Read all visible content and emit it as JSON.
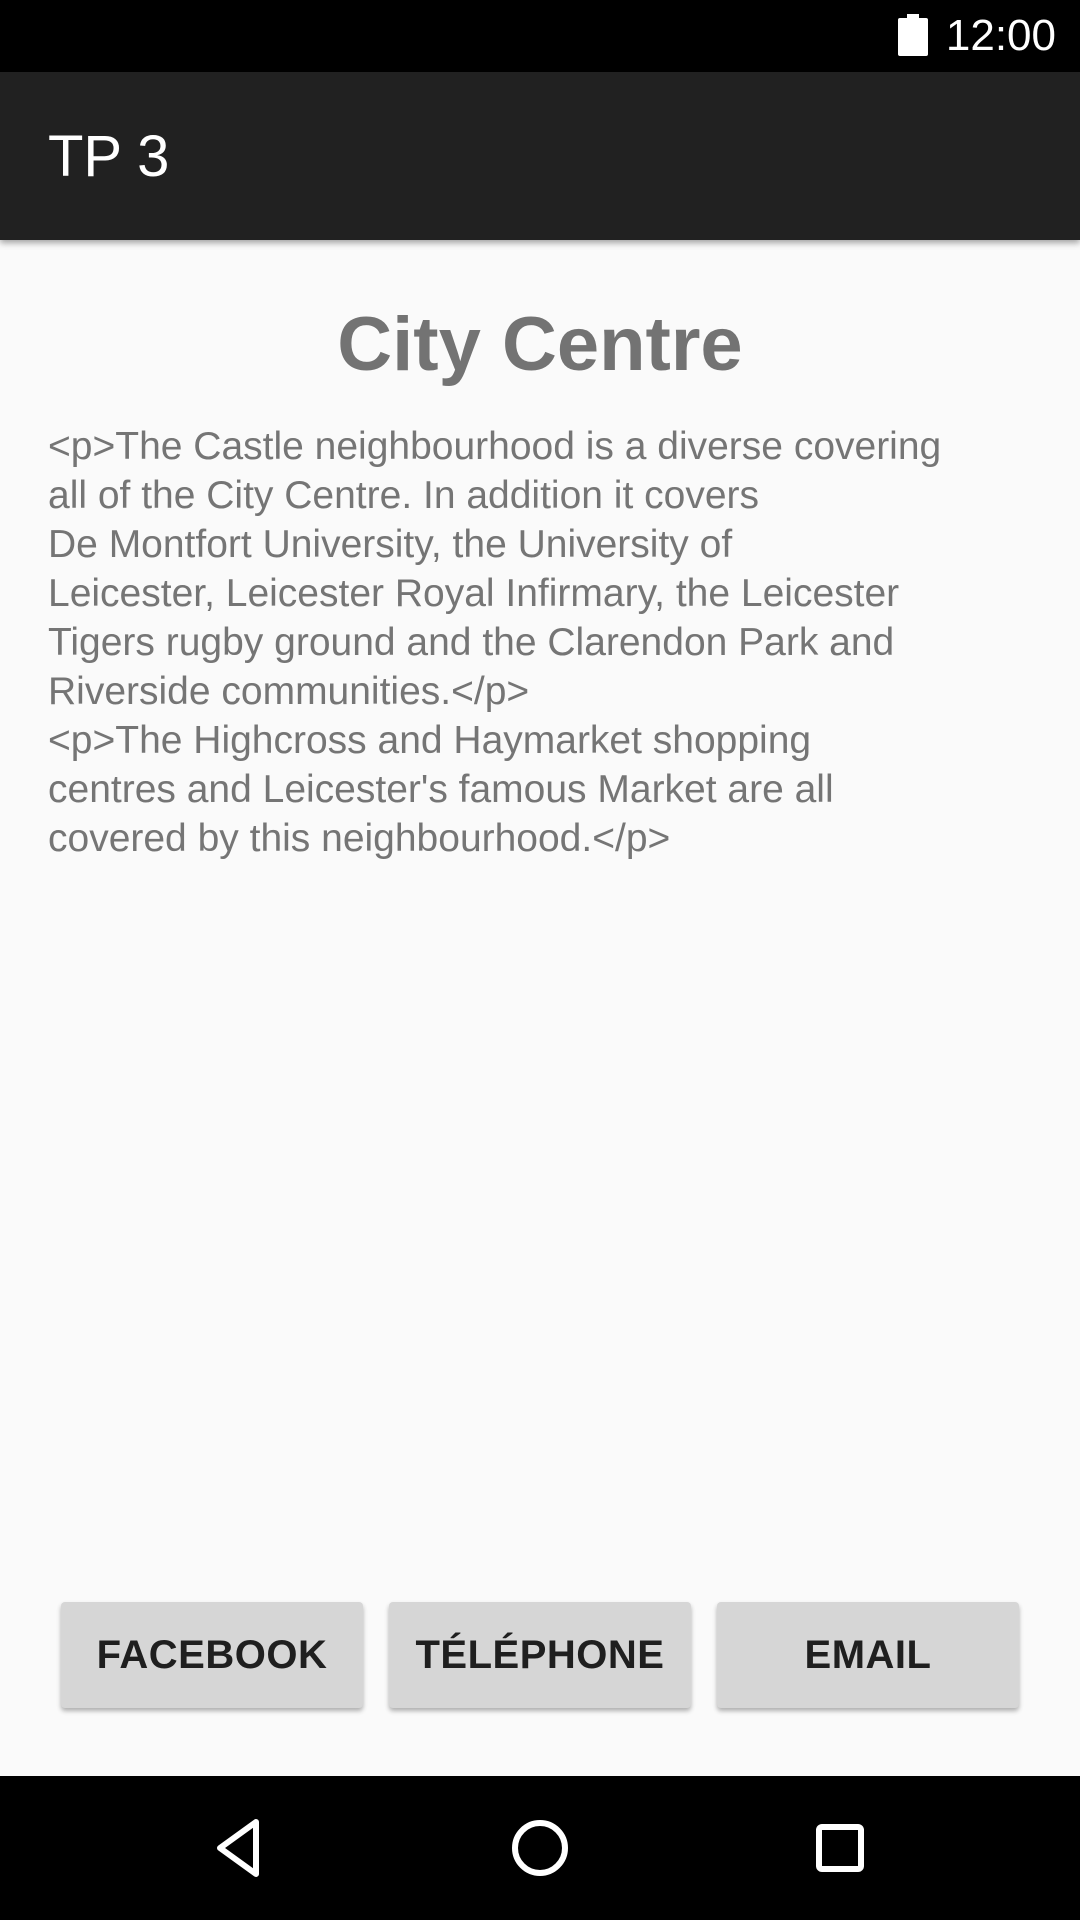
{
  "status_bar": {
    "time": "12:00",
    "battery_icon": "battery-full-icon"
  },
  "app_bar": {
    "title": "TP 3"
  },
  "content": {
    "heading": "City Centre",
    "body": "<p>The Castle neighbourhood is a diverse covering\nall of the City Centre. In addition it covers\nDe Montfort University, the University of\nLeicester, Leicester Royal Infirmary, the Leicester\nTigers rugby ground and the Clarendon Park and\nRiverside communities.</p>\n<p>The Highcross and Haymarket shopping\ncentres and Leicester's famous Market are all\ncovered by this neighbourhood.</p>"
  },
  "buttons": {
    "facebook": "FACEBOOK",
    "telephone": "TÉLÉPHONE",
    "email": "EMAIL"
  },
  "nav_bar": {
    "back_icon": "back-icon",
    "home_icon": "home-icon",
    "recent_icon": "recent-apps-icon"
  },
  "colors": {
    "status_bar": "#000000",
    "app_bar": "#212121",
    "background": "#fafafa",
    "button": "#d6d6d6",
    "text_gray": "#757575"
  }
}
